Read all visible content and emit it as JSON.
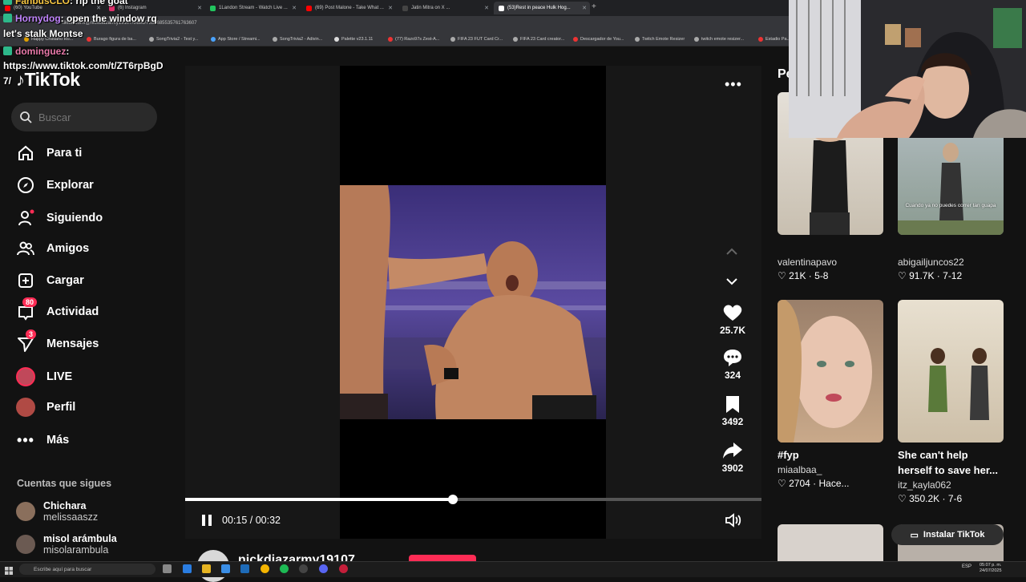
{
  "browser": {
    "tabs": [
      {
        "label": "(60) YouTube",
        "color": "#ff0000"
      },
      {
        "label": "(6) Instagram",
        "color": "#e1306c"
      },
      {
        "label": "1Landon Stream - Watch Live ...",
        "color": "#22c55e"
      },
      {
        "label": "(69) Post Malone - Take What ...",
        "color": "#ff0000"
      },
      {
        "label": "Jatin Mitra on X ...",
        "color": "#000000"
      },
      {
        "label": "(53)Rest in peace Hulk Hog...",
        "color": "#ffffff"
      }
    ],
    "url": "tiktok.com/@nickdiazarmy19107/video/7530685535761763607",
    "bookmarks": [
      "Happy Cristiano Ro...",
      "Burago figura de ba...",
      "SongTrivia2 - Test y...",
      "App Store / Streami...",
      "SongTrivia2 - Adivin...",
      "Palette v23.1.11",
      "(77) Razo97s Zest-A...",
      "FIFA 23 FUT Card Cr...",
      "FIFA 23 Card creator...",
      "Descargador de You...",
      "Twitch Emote Resizer",
      "twitch emote resizer...",
      "Estadio Pa..."
    ]
  },
  "chat": [
    {
      "user": "FanbusCLO",
      "text": ": rip the goat",
      "color": "#f5c542"
    },
    {
      "user": "Hornydog",
      "text": ": open the window rq",
      "color": "#c084fc"
    },
    {
      "user": "",
      "text": "let's stalk Montse",
      "color": "#ffffff"
    },
    {
      "user": "dominguez",
      "text": ":",
      "color": "#e879a9"
    },
    {
      "user": "",
      "text": "https://www.tiktok.com/t/ZT6rpBgD",
      "color": "#ffffff"
    },
    {
      "user": "",
      "text": "7/",
      "color": "#ffffff"
    }
  ],
  "sidebar": {
    "logo": "TikTok",
    "search_placeholder": "Buscar",
    "nav": [
      {
        "label": "Para ti",
        "icon": "home-icon"
      },
      {
        "label": "Explorar",
        "icon": "compass-icon"
      },
      {
        "label": "Siguiendo",
        "icon": "person-icon"
      },
      {
        "label": "Amigos",
        "icon": "friends-icon"
      },
      {
        "label": "Cargar",
        "icon": "upload-icon"
      },
      {
        "label": "Actividad",
        "icon": "inbox-icon",
        "badge": "80"
      },
      {
        "label": "Mensajes",
        "icon": "send-icon",
        "badge": "3"
      },
      {
        "label": "LIVE",
        "icon": "live-icon"
      },
      {
        "label": "Perfil",
        "icon": "profile-icon"
      },
      {
        "label": "Más",
        "icon": "more-icon"
      }
    ],
    "following_title": "Cuentas que sigues",
    "following": [
      {
        "name": "Chichara",
        "handle": "melissaaszz"
      },
      {
        "name": "misol arámbula",
        "handle": "misolarambula"
      }
    ]
  },
  "video": {
    "progress": 0.465,
    "time": "00:15 / 00:32",
    "author": "nickdiazarmy19107",
    "actions": [
      {
        "icon": "heart-icon",
        "count": "25.7K"
      },
      {
        "icon": "comment-icon",
        "count": "324"
      },
      {
        "icon": "bookmark-icon",
        "count": "3492"
      },
      {
        "icon": "share-icon",
        "count": "3902"
      }
    ]
  },
  "right": {
    "heading": "Pe",
    "cards": [
      {
        "title": "",
        "user": "valentinapavo",
        "likes": "21K",
        "date": "5-8"
      },
      {
        "title": "",
        "user": "abigailjuncos22",
        "likes": "91.7K",
        "date": "7-12",
        "overlay": "Cuando ya no puedes correr tan guapa"
      },
      {
        "title": "#fyp",
        "user": "miaalbaa_",
        "likes": "2704",
        "date": "Hace..."
      },
      {
        "title": "She can't help herself to save her...",
        "user": "itz_kayla062",
        "likes": "350.2K",
        "date": "7-6"
      }
    ],
    "install_label": "Instalar TikTok"
  },
  "taskbar": {
    "search_placeholder": "Escribe aquí para buscar",
    "time": "05:07 p. m.",
    "date": "24/07/2025",
    "lang": "ESP"
  },
  "colors": {
    "accent": "#fe2c55",
    "bg": "#121212"
  }
}
